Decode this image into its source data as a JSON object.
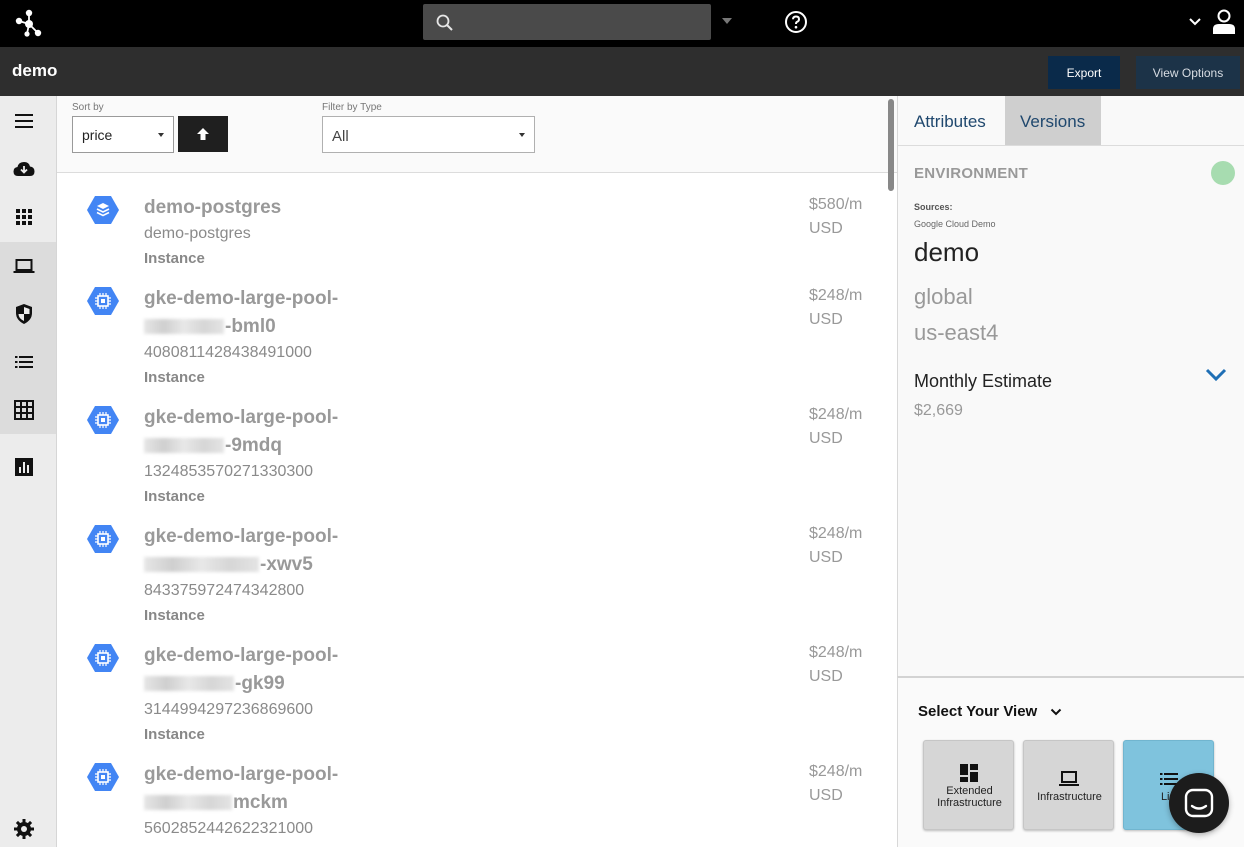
{
  "search": {
    "value": "",
    "placeholder": ""
  },
  "header": {
    "title": "demo",
    "export_label": "Export",
    "view_options_label": "View Options"
  },
  "toolbar": {
    "sort_label": "Sort by",
    "sort_value": "price",
    "filter_label": "Filter by Type",
    "filter_value": "All"
  },
  "sidebar": {
    "items": [
      {
        "icon": "menu-icon"
      },
      {
        "icon": "cloud-download-icon"
      },
      {
        "icon": "apps-grid-icon"
      },
      {
        "icon": "laptop-icon"
      },
      {
        "icon": "shield-icon"
      },
      {
        "icon": "list-icon"
      },
      {
        "icon": "table-grid-icon"
      },
      {
        "icon": "bar-chart-icon"
      },
      {
        "icon": "gear-icon"
      }
    ]
  },
  "resources": [
    {
      "name_line1": "demo-postgres",
      "name_line2": "",
      "id": "demo-postgres",
      "type": "Instance",
      "price": "$580/m",
      "currency": "USD",
      "icon": "database-icon"
    },
    {
      "name_line1": "gke-demo-large-pool-",
      "name_line2": "-bml0",
      "id": "4080811428438491000",
      "type": "Instance",
      "price": "$248/m",
      "currency": "USD",
      "icon": "compute-chip-icon"
    },
    {
      "name_line1": "gke-demo-large-pool-",
      "name_line2": "-9mdq",
      "id": "1324853570271330300",
      "type": "Instance",
      "price": "$248/m",
      "currency": "USD",
      "icon": "compute-chip-icon"
    },
    {
      "name_line1": "gke-demo-large-pool-",
      "name_line2": "-xwv5",
      "id": "843375972474342800",
      "type": "Instance",
      "price": "$248/m",
      "currency": "USD",
      "icon": "compute-chip-icon"
    },
    {
      "name_line1": "gke-demo-large-pool-",
      "name_line2": "-gk99",
      "id": "3144994297236869600",
      "type": "Instance",
      "price": "$248/m",
      "currency": "USD",
      "icon": "compute-chip-icon"
    },
    {
      "name_line1": "gke-demo-large-pool-",
      "name_line2": "mckm",
      "id": "5602852442622321000",
      "type": "Instance",
      "price": "$248/m",
      "currency": "USD",
      "icon": "compute-chip-icon"
    }
  ],
  "panel": {
    "tabs": [
      "Attributes",
      "Versions"
    ],
    "env_label": "ENVIRONMENT",
    "status_color": "#a7dcb0",
    "sources_label": "Sources:",
    "sources_value": "Google Cloud Demo",
    "env_name": "demo",
    "regions": [
      "global",
      "us-east4"
    ],
    "estimate_label": "Monthly Estimate",
    "estimate_value": "$2,669"
  },
  "view_selector": {
    "title": "Select Your View",
    "cards": [
      {
        "line1": "Extended",
        "line2": "Infrastructure"
      },
      {
        "line1": "Infrastructure",
        "line2": ""
      },
      {
        "line1": "List",
        "line2": ""
      }
    ]
  },
  "colors": {
    "accent": "#1f6fb5",
    "header_bg": "#000000",
    "subbar_bg": "#2e2e2e",
    "export_bg": "#0a2a4a",
    "icon_blue": "#4285f4"
  }
}
